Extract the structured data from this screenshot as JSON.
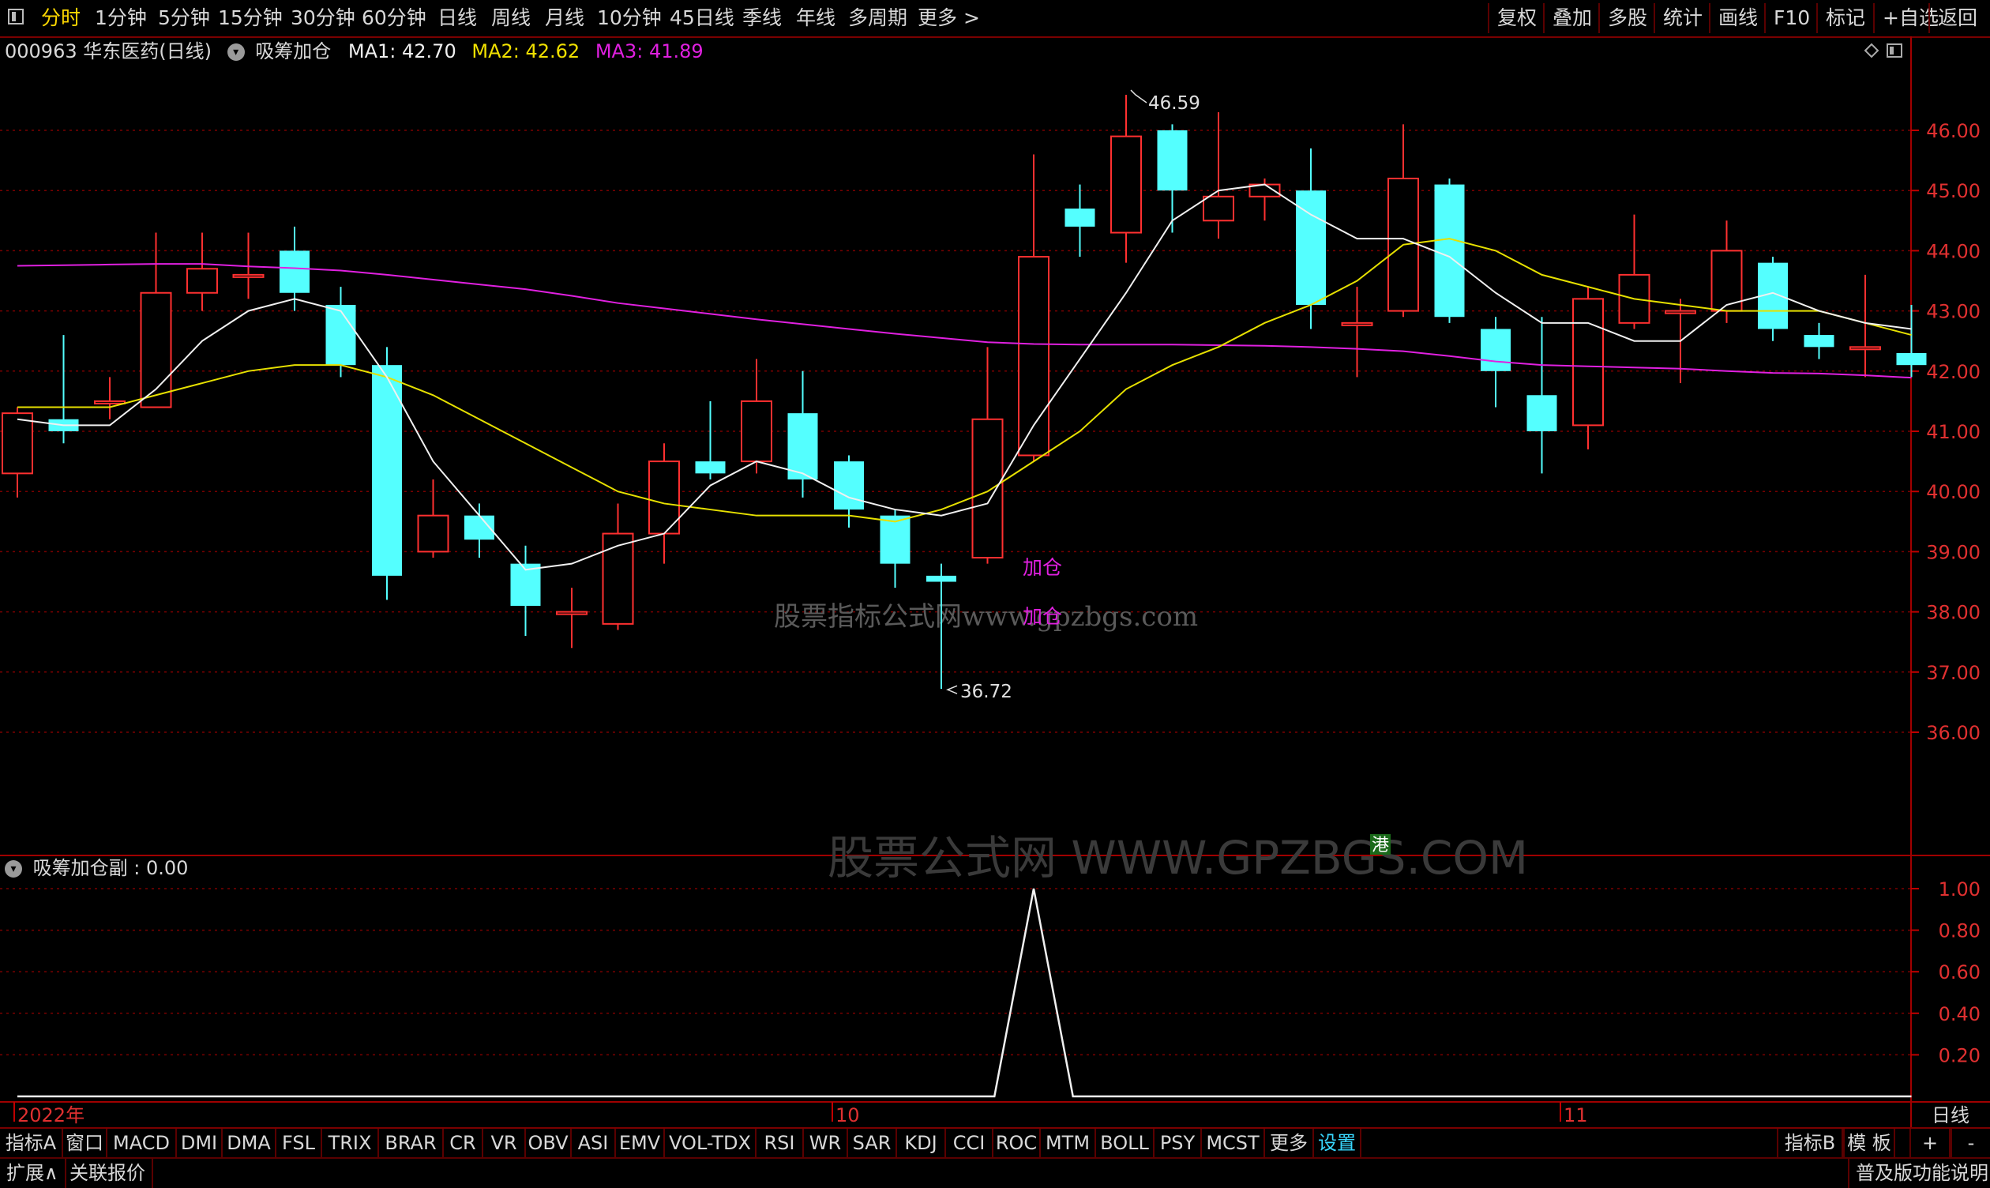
{
  "topbar": {
    "periods": [
      "分时",
      "1分钟",
      "5分钟",
      "15分钟",
      "30分钟",
      "60分钟",
      "日线",
      "周线",
      "月线",
      "10分钟",
      "45日线",
      "季线",
      "年线",
      "多周期",
      "更多 >"
    ],
    "active_index": 0,
    "right_buttons": [
      "复权",
      "叠加",
      "多股",
      "统计",
      "画线",
      "F10",
      "标记",
      "+自选",
      "返回"
    ]
  },
  "chart_title": {
    "stock": "000963 华东医药(日线)",
    "indicator": "吸筹加仓",
    "ma1": "MA1: 42.70",
    "ma2": "MA2: 42.62",
    "ma3": "MA3: 41.89"
  },
  "main_chart": {
    "price_ticks": [
      "46.00",
      "45.00",
      "44.00",
      "43.00",
      "42.00",
      "41.00",
      "40.00",
      "39.00",
      "38.00",
      "37.00",
      "36.00"
    ],
    "high_label": "46.59",
    "low_label": "36.72",
    "signal_labels": [
      "加仓",
      "加仓"
    ],
    "watermark_small": "股票指标公式网www.gpzbgs.com",
    "watermark_large": "股票公式网 WWW.GPZBGS.COM",
    "hk_badge": "港"
  },
  "sub_chart": {
    "title": "吸筹加仓副 : 0.00",
    "value_ticks": [
      "1.00",
      "0.80",
      "0.60",
      "0.40",
      "0.20"
    ]
  },
  "date_axis": {
    "labels": [
      "2022年",
      "10",
      "11"
    ],
    "period_label": "日线"
  },
  "bottom_tabs": [
    "指标A",
    "窗口",
    "MACD",
    "DMI",
    "DMA",
    "FSL",
    "TRIX",
    "BRAR",
    "CR",
    "VR",
    "OBV",
    "ASI",
    "EMV",
    "VOL-TDX",
    "RSI",
    "WR",
    "SAR",
    "KDJ",
    "CCI",
    "ROC",
    "MTM",
    "BOLL",
    "PSY",
    "MCST",
    "更多",
    "设置"
  ],
  "bottom_right": [
    "指标B",
    "模 板",
    "+",
    "-"
  ],
  "status_bar": {
    "left": [
      "扩展∧",
      "关联报价"
    ],
    "right": "普及版功能说明"
  },
  "chart_data": {
    "type": "candlestick",
    "ylim": [
      35.0,
      47.5
    ],
    "candles": [
      {
        "o": 40.3,
        "h": 41.4,
        "l": 39.9,
        "c": 41.3
      },
      {
        "o": 41.2,
        "h": 42.6,
        "l": 40.8,
        "c": 41.0
      },
      {
        "o": 41.5,
        "h": 41.9,
        "l": 41.2,
        "c": 41.5
      },
      {
        "o": 41.4,
        "h": 44.3,
        "l": 41.4,
        "c": 43.3
      },
      {
        "o": 43.3,
        "h": 44.3,
        "l": 43.0,
        "c": 43.7
      },
      {
        "o": 43.6,
        "h": 44.3,
        "l": 43.2,
        "c": 43.6
      },
      {
        "o": 44.0,
        "h": 44.4,
        "l": 43.0,
        "c": 43.3
      },
      {
        "o": 43.1,
        "h": 43.4,
        "l": 41.9,
        "c": 42.1
      },
      {
        "o": 42.1,
        "h": 42.4,
        "l": 38.2,
        "c": 38.6
      },
      {
        "o": 39.0,
        "h": 40.2,
        "l": 38.9,
        "c": 39.6
      },
      {
        "o": 39.6,
        "h": 39.8,
        "l": 38.9,
        "c": 39.2
      },
      {
        "o": 38.8,
        "h": 39.1,
        "l": 37.6,
        "c": 38.1
      },
      {
        "o": 38.0,
        "h": 38.4,
        "l": 37.4,
        "c": 38.0
      },
      {
        "o": 37.8,
        "h": 39.8,
        "l": 37.7,
        "c": 39.3
      },
      {
        "o": 39.3,
        "h": 40.8,
        "l": 38.8,
        "c": 40.5
      },
      {
        "o": 40.5,
        "h": 41.5,
        "l": 40.2,
        "c": 40.3
      },
      {
        "o": 40.5,
        "h": 42.2,
        "l": 40.3,
        "c": 41.5
      },
      {
        "o": 41.3,
        "h": 42.0,
        "l": 39.9,
        "c": 40.2
      },
      {
        "o": 40.5,
        "h": 40.6,
        "l": 39.4,
        "c": 39.7
      },
      {
        "o": 39.6,
        "h": 39.7,
        "l": 38.4,
        "c": 38.8
      },
      {
        "o": 38.6,
        "h": 38.8,
        "l": 36.72,
        "c": 38.5
      },
      {
        "o": 38.9,
        "h": 42.4,
        "l": 38.8,
        "c": 41.2
      },
      {
        "o": 40.6,
        "h": 45.6,
        "l": 40.5,
        "c": 43.9
      },
      {
        "o": 44.7,
        "h": 45.1,
        "l": 43.9,
        "c": 44.4
      },
      {
        "o": 44.3,
        "h": 46.59,
        "l": 43.8,
        "c": 45.9
      },
      {
        "o": 46.0,
        "h": 46.1,
        "l": 44.3,
        "c": 45.0
      },
      {
        "o": 44.5,
        "h": 46.3,
        "l": 44.2,
        "c": 44.9
      },
      {
        "o": 44.9,
        "h": 45.2,
        "l": 44.5,
        "c": 45.1
      },
      {
        "o": 45.0,
        "h": 45.7,
        "l": 42.7,
        "c": 43.1
      },
      {
        "o": 42.8,
        "h": 43.4,
        "l": 41.9,
        "c": 42.8
      },
      {
        "o": 43.0,
        "h": 46.1,
        "l": 42.9,
        "c": 45.2
      },
      {
        "o": 45.1,
        "h": 45.2,
        "l": 42.8,
        "c": 42.9
      },
      {
        "o": 42.7,
        "h": 42.9,
        "l": 41.4,
        "c": 42.0
      },
      {
        "o": 41.6,
        "h": 42.9,
        "l": 40.3,
        "c": 41.0
      },
      {
        "o": 41.1,
        "h": 43.4,
        "l": 40.7,
        "c": 43.2
      },
      {
        "o": 42.8,
        "h": 44.6,
        "l": 42.7,
        "c": 43.6
      },
      {
        "o": 43.0,
        "h": 43.2,
        "l": 41.8,
        "c": 43.0
      },
      {
        "o": 43.0,
        "h": 44.5,
        "l": 42.8,
        "c": 44.0
      },
      {
        "o": 43.8,
        "h": 43.9,
        "l": 42.5,
        "c": 42.7
      },
      {
        "o": 42.6,
        "h": 42.8,
        "l": 42.2,
        "c": 42.4
      },
      {
        "o": 42.4,
        "h": 43.6,
        "l": 41.9,
        "c": 42.4
      },
      {
        "o": 42.3,
        "h": 43.1,
        "l": 41.9,
        "c": 42.1
      }
    ],
    "ma1": [
      41.2,
      41.1,
      41.1,
      41.7,
      42.5,
      43.0,
      43.2,
      43.0,
      41.9,
      40.5,
      39.6,
      38.7,
      38.8,
      39.1,
      39.3,
      40.1,
      40.5,
      40.3,
      39.9,
      39.7,
      39.6,
      39.8,
      41.1,
      42.2,
      43.3,
      44.5,
      45.0,
      45.1,
      44.6,
      44.2,
      44.2,
      43.9,
      43.3,
      42.8,
      42.8,
      42.5,
      42.5,
      43.1,
      43.3,
      43.0,
      42.8,
      42.7
    ],
    "ma2": [
      41.4,
      41.4,
      41.4,
      41.6,
      41.8,
      42.0,
      42.1,
      42.1,
      41.9,
      41.6,
      41.2,
      40.8,
      40.4,
      40.0,
      39.8,
      39.7,
      39.6,
      39.6,
      39.6,
      39.5,
      39.7,
      40.0,
      40.5,
      41.0,
      41.7,
      42.1,
      42.4,
      42.8,
      43.1,
      43.5,
      44.1,
      44.2,
      44.0,
      43.6,
      43.4,
      43.2,
      43.1,
      43.0,
      43.0,
      43.0,
      42.8,
      42.6
    ],
    "ma3": [
      43.75,
      43.76,
      43.77,
      43.78,
      43.78,
      43.74,
      43.71,
      43.67,
      43.6,
      43.52,
      43.44,
      43.36,
      43.25,
      43.13,
      43.04,
      42.95,
      42.86,
      42.78,
      42.7,
      42.62,
      42.55,
      42.48,
      42.45,
      42.44,
      42.44,
      42.44,
      42.43,
      42.42,
      42.4,
      42.37,
      42.33,
      42.25,
      42.16,
      42.1,
      42.08,
      42.06,
      42.04,
      42.0,
      41.97,
      41.96,
      41.93,
      41.89
    ],
    "signal_index": 22,
    "sub_ylim": [
      0,
      1.0
    ]
  }
}
